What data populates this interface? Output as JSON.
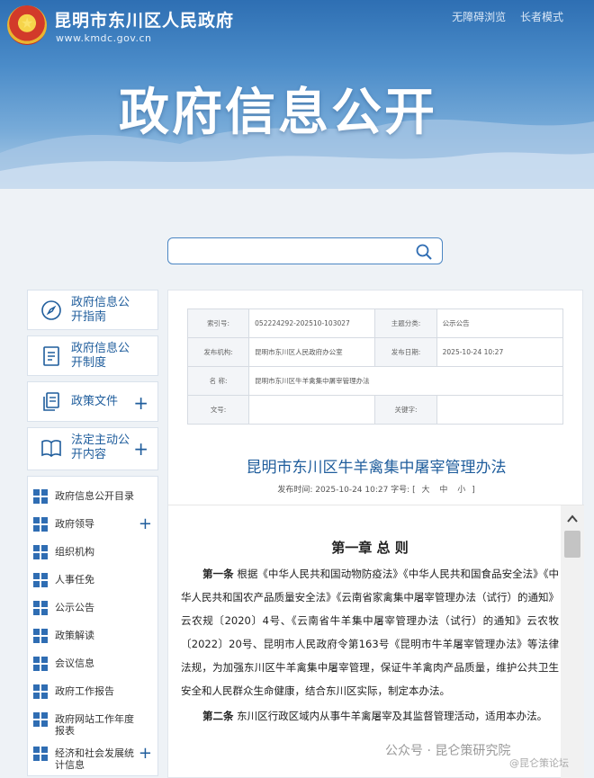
{
  "header": {
    "site_name": "昆明市东川区人民政府",
    "site_url": "www.kmdc.gov.cn",
    "accessibility": "无障碍浏览",
    "elder_mode": "长者模式",
    "emblem_glyph": "★",
    "banner_title": "政府信息公开"
  },
  "search": {
    "placeholder": ""
  },
  "sidebar": {
    "cards": [
      {
        "label": "政府信息公开指南",
        "icon": "compass-icon"
      },
      {
        "label": "政府信息公开制度",
        "icon": "document-icon"
      },
      {
        "label": "政策文件",
        "icon": "file-copy-icon",
        "plus": "+"
      },
      {
        "label": "法定主动公开内容",
        "icon": "book-icon",
        "plus": "+"
      }
    ],
    "sub_items": [
      {
        "label": "政府信息公开目录"
      },
      {
        "label": "政府领导",
        "plus": "+"
      },
      {
        "label": "组织机构"
      },
      {
        "label": "人事任免"
      },
      {
        "label": "公示公告"
      },
      {
        "label": "政策解读"
      },
      {
        "label": "会议信息"
      },
      {
        "label": "政府工作报告"
      },
      {
        "label": "政府网站工作年度报表"
      },
      {
        "label": "经济和社会发展统计信息",
        "plus": "+"
      }
    ]
  },
  "meta": {
    "index_label": "索引号:",
    "index_value": "052224292-202510-103027",
    "topic_label": "主题分类:",
    "topic_value": "公示公告",
    "org_label": "发布机构:",
    "org_value": "昆明市东川区人民政府办公室",
    "date_label": "发布日期:",
    "date_value": "2025-10-24 10:27",
    "name_label": "名    称:",
    "name_value": "昆明市东川区牛羊禽集中屠宰管理办法",
    "docno_label": "文号:",
    "docno_value": "",
    "keyword_label": "关键字:",
    "keyword_value": ""
  },
  "article": {
    "title": "昆明市东川区牛羊禽集中屠宰管理办法",
    "pub_prefix": "发布时间: 2025-10-24 10:27 字号: [",
    "size_large": "大",
    "size_medium": "中",
    "size_small": "小",
    "pub_suffix": "]",
    "chapter": "第一章 总 则",
    "p1_lead": "第一条",
    "p1_text": " 根据《中华人民共和国动物防疫法》《中华人民共和国食品安全法》《中华人民共和国农产品质量安全法》《云南省家禽集中屠宰管理办法（试行）的通知》云农规〔2020〕4号、《云南省牛羊集中屠宰管理办法（试行）的通知》云农牧〔2022〕20号、昆明市人民政府令第163号《昆明市牛羊屠宰管理办法》等法律法规，为加强东川区牛羊禽集中屠宰管理，保证牛羊禽肉产品质量，维护公共卫生安全和人民群众生命健康，结合东川区实际，制定本办法。",
    "p2_lead": "第二条",
    "p2_text": " 东川区行政区域内从事牛羊禽屠宰及其监督管理活动，适用本办法。"
  },
  "watermark": {
    "line1": "公众号 · 昆仑策研究院",
    "line2": "@昆仑策论坛"
  },
  "colors": {
    "accent": "#1f5d9c",
    "banner_top": "#2e6fb3"
  }
}
